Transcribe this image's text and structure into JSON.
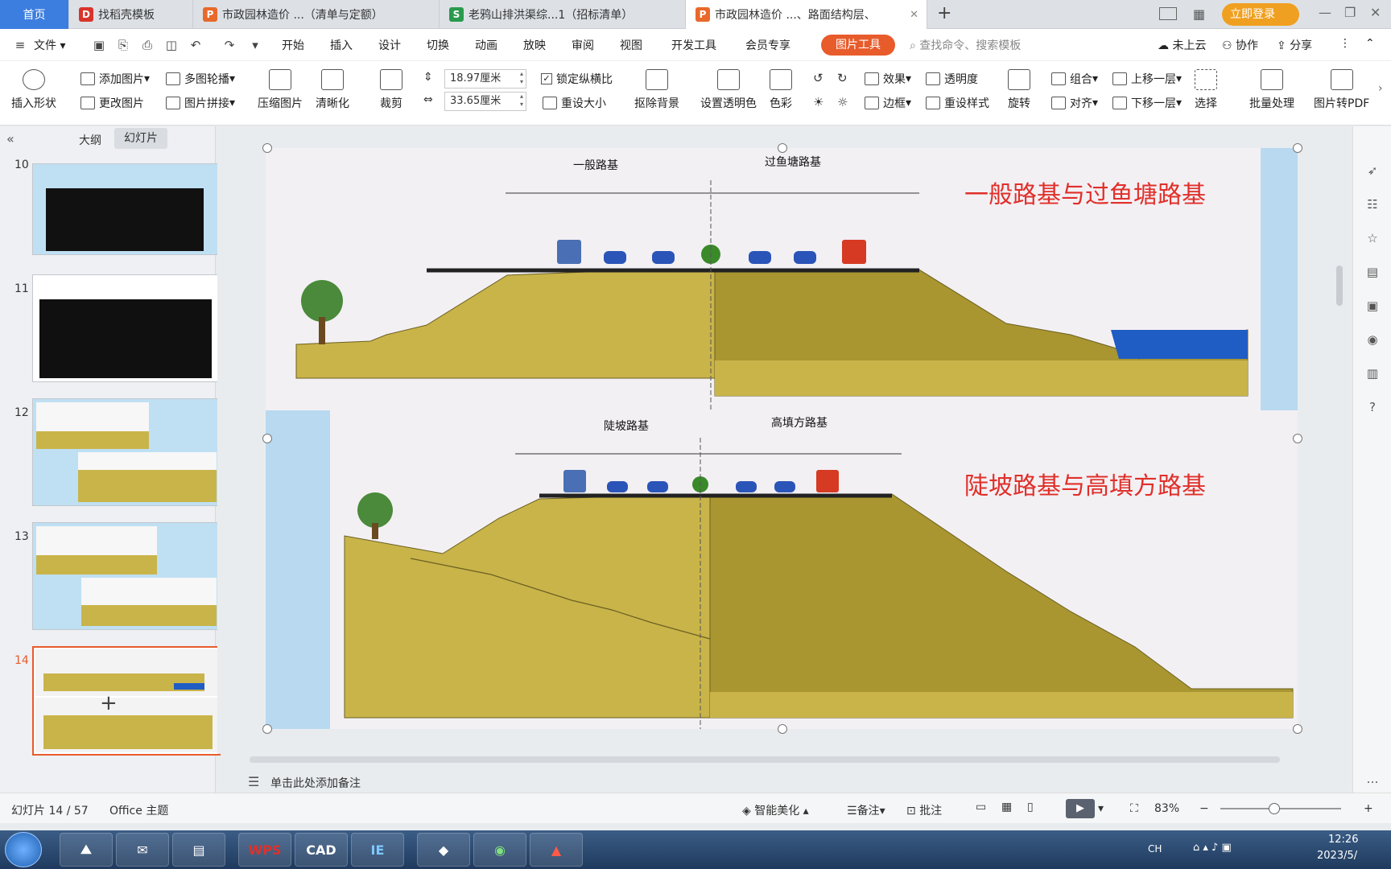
{
  "tabs": {
    "home": "首页",
    "t1": "找稻壳模板",
    "t2": "市政园林造价 ...（清单与定额）",
    "t3": "老鸦山排洪渠综...1（招标清单）",
    "t4": "市政园林造价 ...、路面结构层、",
    "add": "+",
    "login": "立即登录"
  },
  "menu": {
    "file": "文件",
    "items": [
      "开始",
      "插入",
      "设计",
      "切换",
      "动画",
      "放映",
      "审阅",
      "视图",
      "开发工具",
      "会员专享"
    ],
    "picture_tools": "图片工具",
    "search_placeholder": "查找命令、搜索模板",
    "cloud": "未上云",
    "collab": "协作",
    "share": "分享"
  },
  "ribbon": {
    "insert_shape": "插入形状",
    "add_picture": "添加图片",
    "multi_carousel": "多图轮播",
    "change_picture": "更改图片",
    "picture_stitch": "图片拼接",
    "compress": "压缩图片",
    "sharpen": "清晰化",
    "crop": "裁剪",
    "height": "18.97厘米",
    "width": "33.65厘米",
    "lock_ratio": "锁定纵横比",
    "resize": "重设大小",
    "remove_bg": "抠除背景",
    "set_transparent": "设置透明色",
    "color": "色彩",
    "effects": "效果",
    "border": "边框",
    "transparency": "透明度",
    "reset_style": "重设样式",
    "rotate": "旋转",
    "group": "组合",
    "align": "对齐",
    "bring_forward": "上移一层",
    "send_backward": "下移一层",
    "select": "选择",
    "batch": "批量处理",
    "to_pdf": "图片转PDF"
  },
  "panel": {
    "outline": "大纲",
    "slides": "幻灯片",
    "numbers": [
      "10",
      "11",
      "12",
      "13",
      "14"
    ],
    "add": "+"
  },
  "slide": {
    "top_title": "一般路基与过鱼塘路基",
    "bottom_title": "陡坡路基与高填方路基",
    "top_left_label": "一般路基",
    "top_right_label": "过鱼塘路基",
    "bottom_left_label": "陡坡路基",
    "bottom_right_label": "高填方路基"
  },
  "notes": {
    "placeholder": "单击此处添加备注"
  },
  "status": {
    "slide_count": "幻灯片 14 / 57",
    "theme": "Office 主题",
    "beautify": "智能美化",
    "notes": "备注",
    "comment": "批注",
    "zoom": "83%"
  },
  "taskbar": {
    "apps": [
      "WPS",
      "CAD",
      "IE"
    ],
    "lang": "CH",
    "time": "12:26",
    "date": "2023/5/"
  },
  "colors": {
    "accent": "#3c7ee0",
    "picture_tools": "#e85b2b",
    "login": "#f0a020",
    "slide_title": "#e0302a",
    "soil": "#c9b44a",
    "soil_dark": "#a99631",
    "water": "#1f5cc4",
    "sky": "#b8d9f0"
  }
}
